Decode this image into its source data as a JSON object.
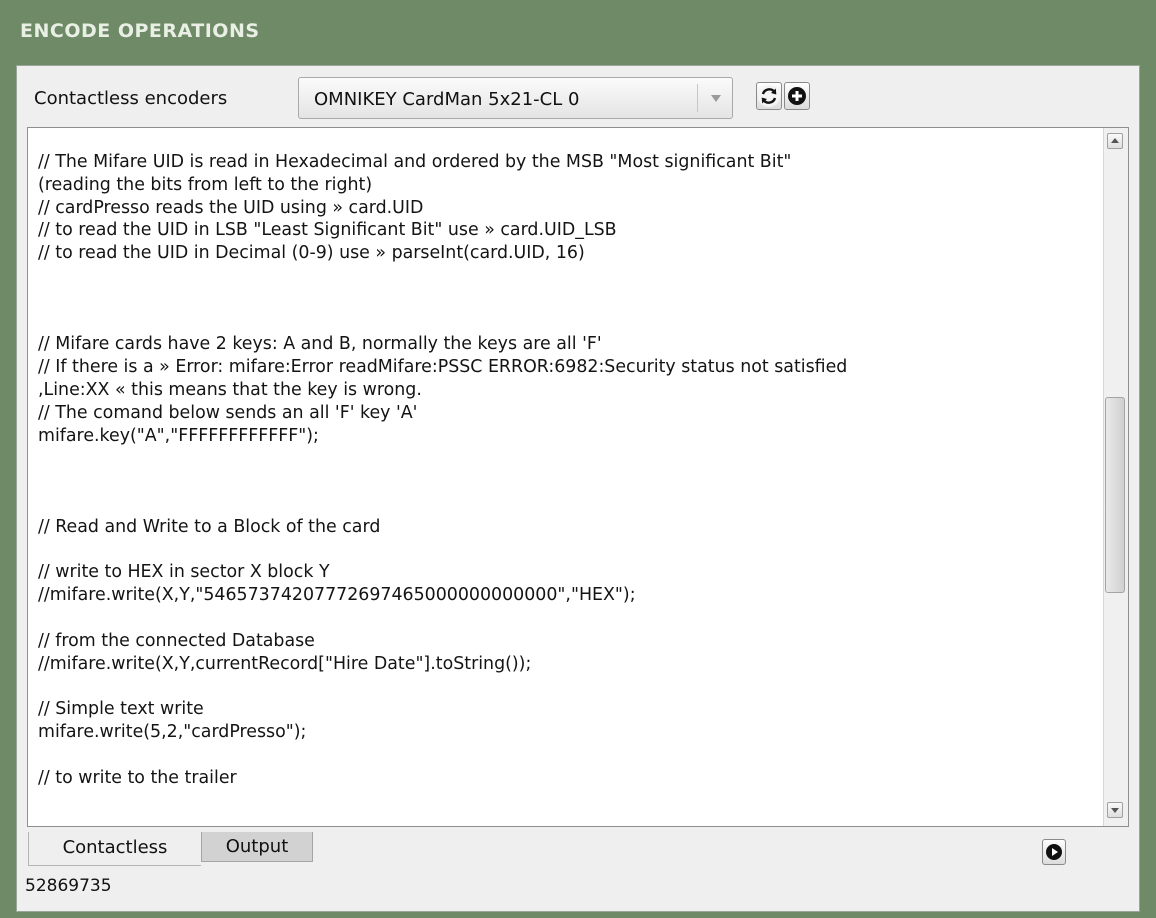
{
  "header": {
    "title": "ENCODE OPERATIONS"
  },
  "encoders": {
    "label": "Contactless encoders",
    "selected": "OMNIKEY CardMan 5x21-CL 0",
    "refresh_icon": "refresh-icon",
    "add_icon": "add-circle-icon"
  },
  "editor": {
    "lines": [
      "// The Mifare UID is read in Hexadecimal and ordered by the MSB \"Most significant Bit\"",
      "(reading the bits from left to the right)",
      "// cardPresso reads the UID using » card.UID",
      "// to read the UID in LSB \"Least Significant Bit\" use » card.UID_LSB",
      "// to read the UID in Decimal (0-9) use » parseInt(card.UID, 16)",
      "",
      "",
      "",
      "// Mifare cards have 2 keys: A and B, normally the keys are all 'F'",
      "// If there is a » Error: mifare:Error readMifare:PSSC ERROR:6982:Security status not satisfied",
      ",Line:XX « this means that the key is wrong.",
      "// The comand below sends an all 'F' key 'A'",
      "mifare.key(\"A\",\"FFFFFFFFFFFF\");",
      "",
      "",
      "",
      "// Read and Write to a Block of the card",
      "",
      "// write to HEX in sector X block Y",
      "//mifare.write(X,Y,\"54657374207772697465000000000000\",\"HEX\");",
      "",
      "// from the connected Database",
      "//mifare.write(X,Y,currentRecord[\"Hire Date\"].toString());",
      "",
      "// Simple text write",
      "mifare.write(5,2,\"cardPresso\");",
      "",
      "// to write to the trailer"
    ]
  },
  "tabs": [
    {
      "label": "Contactless",
      "active": true
    },
    {
      "label": "Output",
      "active": false
    }
  ],
  "run_icon": "play-circle-icon",
  "status": {
    "value": "52869735"
  }
}
